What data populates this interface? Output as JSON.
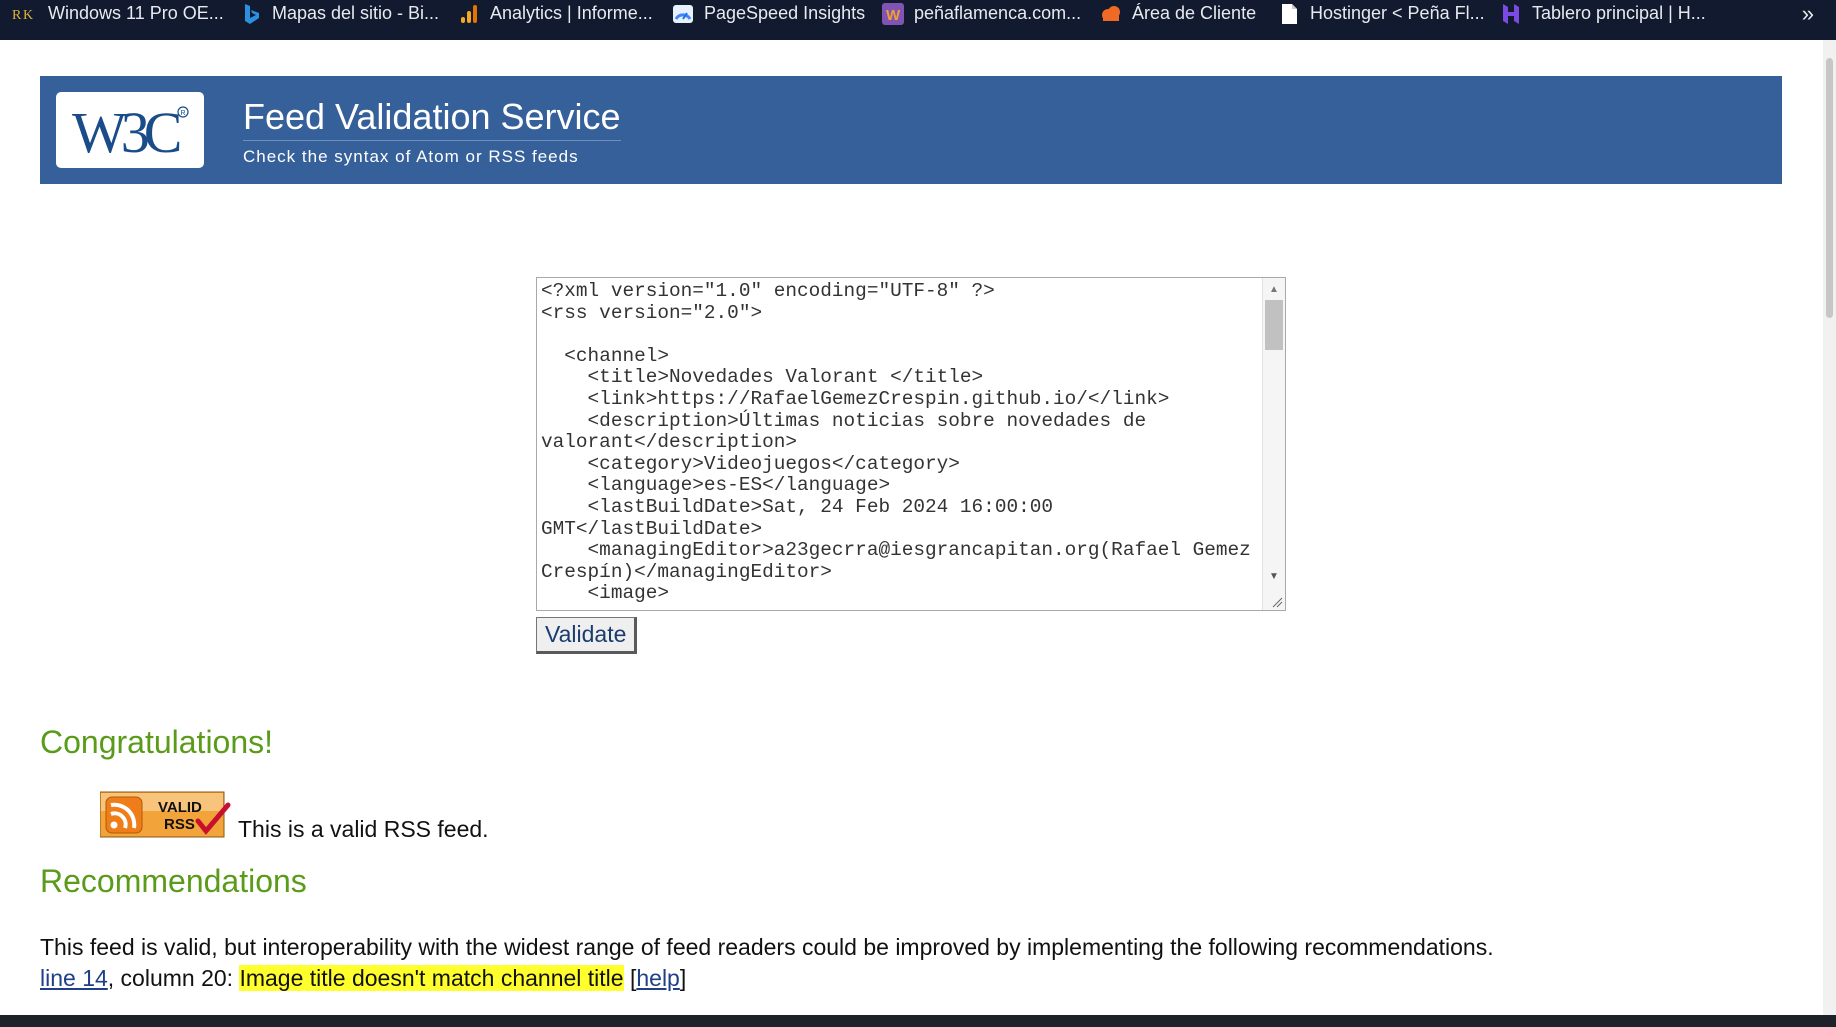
{
  "bookmarks": [
    {
      "label": "Windows 11 Pro OE...",
      "icon": "rk-icon"
    },
    {
      "label": "Mapas del sitio - Bi...",
      "icon": "bing-icon"
    },
    {
      "label": "Analytics | Informe...",
      "icon": "analytics-icon"
    },
    {
      "label": "PageSpeed Insights",
      "icon": "pagespeed-icon"
    },
    {
      "label": "peñaflamenca.com...",
      "icon": "woo-icon"
    },
    {
      "label": "Área de Cliente",
      "icon": "cloud-icon"
    },
    {
      "label": "Hostinger < Peña Fl...",
      "icon": "page-icon"
    },
    {
      "label": "Tablero principal | H...",
      "icon": "hostinger-icon"
    }
  ],
  "bookmarks_more": "»",
  "header": {
    "logo_text": "W3C",
    "title": "Feed Validation Service",
    "subtitle": "Check the syntax of Atom or RSS feeds"
  },
  "form": {
    "source_text": "<?xml version=\"1.0\" encoding=\"UTF-8\" ?>\n<rss version=\"2.0\">\n\n  <channel>\n    <title>Novedades Valorant </title>\n    <link>https://RafaelGemezCrespin.github.io/</link>\n    <description>Últimas noticias sobre novedades de valorant</description>\n    <category>Videojuegos</category>\n    <language>es-ES</language>\n    <lastBuildDate>Sat, 24 Feb 2024 16:00:00 GMT</lastBuildDate>\n    <managingEditor>a23gecrra@iesgrancapitan.org(Rafael Gemez Crespín)</managingEditor>\n    <image>",
    "validate_label": "Validate"
  },
  "result": {
    "congrats": "Congratulations!",
    "badge_line1": "VALID",
    "badge_line2": "RSS",
    "valid_text": "This is a valid RSS feed.",
    "recommendations_heading": "Recommendations",
    "recommendations_text": "This feed is valid, but interoperability with the widest range of feed readers could be improved by implementing the following recommendations.",
    "issue": {
      "line_link": "line 14",
      "column_text": ", column 20: ",
      "message": "Image title doesn't match channel title",
      "bracket_open": " [",
      "help_link": "help",
      "bracket_close": "]"
    }
  },
  "colors": {
    "banner": "#36609a",
    "heading_green": "#5a9b1a",
    "highlight": "#ffff2d",
    "link": "#1f3f86"
  }
}
